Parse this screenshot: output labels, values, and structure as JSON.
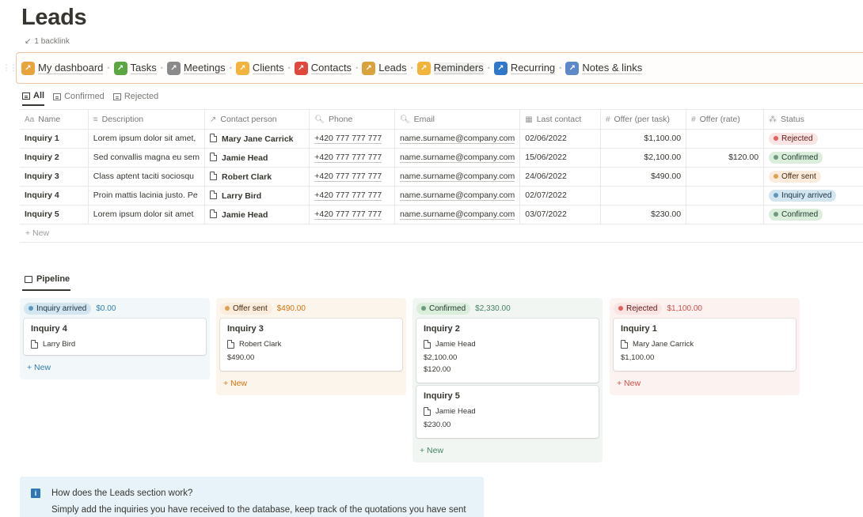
{
  "page": {
    "title": "Leads",
    "backlink": "1 backlink"
  },
  "nav": [
    {
      "label": "My dashboard",
      "icon": "dashboard-icon",
      "color": "#e8a33d"
    },
    {
      "label": "Tasks",
      "icon": "checkbox-icon",
      "color": "#5aa640"
    },
    {
      "label": "Meetings",
      "icon": "microphone-icon",
      "color": "#8a8a8a"
    },
    {
      "label": "Clients",
      "icon": "handshake-icon",
      "color": "#f2b43c"
    },
    {
      "label": "Contacts",
      "icon": "contacts-icon",
      "color": "#e0473d"
    },
    {
      "label": "Leads",
      "icon": "money-bag-icon",
      "color": "#d9a23c"
    },
    {
      "label": "Reminders",
      "icon": "bell-icon",
      "color": "#f2b43c"
    },
    {
      "label": "Recurring",
      "icon": "recurring-icon",
      "color": "#2f77c9"
    },
    {
      "label": "Notes & links",
      "icon": "notes-icon",
      "color": "#5d89c9"
    }
  ],
  "views": [
    "All",
    "Confirmed",
    "Rejected"
  ],
  "table": {
    "headers": [
      {
        "label": "Name",
        "icon": "Aa"
      },
      {
        "label": "Description",
        "icon": "≡"
      },
      {
        "label": "Contact person",
        "icon": "↗"
      },
      {
        "label": "Phone",
        "icon": "🔍︎"
      },
      {
        "label": "Email",
        "icon": "🔍︎"
      },
      {
        "label": "Last contact",
        "icon": "▦"
      },
      {
        "label": "Offer (per task)",
        "icon": "#"
      },
      {
        "label": "Offer (rate)",
        "icon": "#"
      },
      {
        "label": "Status",
        "icon": "⁂"
      }
    ],
    "rows": [
      {
        "name": "Inquiry 1",
        "description": "Lorem ipsum dolor sit amet,",
        "person": "Mary Jane Carrick",
        "phone": "+420 777 777 777",
        "email": "name.surname@company.com",
        "last": "02/06/2022",
        "offer_task": "$1,100.00",
        "offer_rate": "",
        "status": "Rejected"
      },
      {
        "name": "Inquiry 2",
        "description": "Sed convallis magna eu sem",
        "person": "Jamie Head",
        "phone": "+420 777 777 777",
        "email": "name.surname@company.com",
        "last": "15/06/2022",
        "offer_task": "$2,100.00",
        "offer_rate": "$120.00",
        "status": "Confirmed"
      },
      {
        "name": "Inquiry 3",
        "description": "Class aptent taciti sociosqu",
        "person": "Robert Clark",
        "phone": "+420 777 777 777",
        "email": "name.surname@company.com",
        "last": "24/06/2022",
        "offer_task": "$490.00",
        "offer_rate": "",
        "status": "Offer sent"
      },
      {
        "name": "Inquiry 4",
        "description": "Proin mattis lacinia justo. Pe",
        "person": "Larry Bird",
        "phone": "+420 777 777 777",
        "email": "name.surname@company.com",
        "last": "02/07/2022",
        "offer_task": "",
        "offer_rate": "",
        "status": "Inquiry arrived"
      },
      {
        "name": "Inquiry 5",
        "description": "Lorem ipsum dolor sit amet",
        "person": "Jamie Head",
        "phone": "+420 777 777 777",
        "email": "name.surname@company.com",
        "last": "03/07/2022",
        "offer_task": "$230.00",
        "offer_rate": "",
        "status": "Confirmed"
      }
    ],
    "new_label": "+ New"
  },
  "status_colors": {
    "Rejected": "b-red",
    "Confirmed": "b-green",
    "Offer sent": "b-orange",
    "Inquiry arrived": "b-blue"
  },
  "pipeline": {
    "tab": "Pipeline",
    "columns": [
      {
        "status": "Inquiry arrived",
        "total": "$0.00",
        "bg": "#f2f7fa",
        "accent": "#337ea9",
        "cards": [
          {
            "title": "Inquiry 4",
            "person": "Larry Bird",
            "values": []
          }
        ]
      },
      {
        "status": "Offer sent",
        "total": "$490.00",
        "bg": "#fbf5ec",
        "accent": "#d9730d",
        "cards": [
          {
            "title": "Inquiry 3",
            "person": "Robert Clark",
            "values": [
              "$490.00"
            ]
          }
        ]
      },
      {
        "status": "Confirmed",
        "total": "$2,330.00",
        "bg": "#f2f6f3",
        "accent": "#448361",
        "cards": [
          {
            "title": "Inquiry 2",
            "person": "Jamie Head",
            "values": [
              "$2,100.00",
              "$120.00"
            ]
          },
          {
            "title": "Inquiry 5",
            "person": "Jamie Head",
            "values": [
              "$230.00"
            ]
          }
        ]
      },
      {
        "status": "Rejected",
        "total": "$1,100.00",
        "bg": "#fcf3f1",
        "accent": "#d44c47",
        "cards": [
          {
            "title": "Inquiry 1",
            "person": "Mary Jane Carrick",
            "values": [
              "$1,100.00"
            ]
          }
        ]
      }
    ],
    "new_label": "+ New"
  },
  "callout": {
    "title": "How does the Leads section work?",
    "text": "Simply add the inquiries you have received to the database, keep track of the quotations you have sent"
  }
}
